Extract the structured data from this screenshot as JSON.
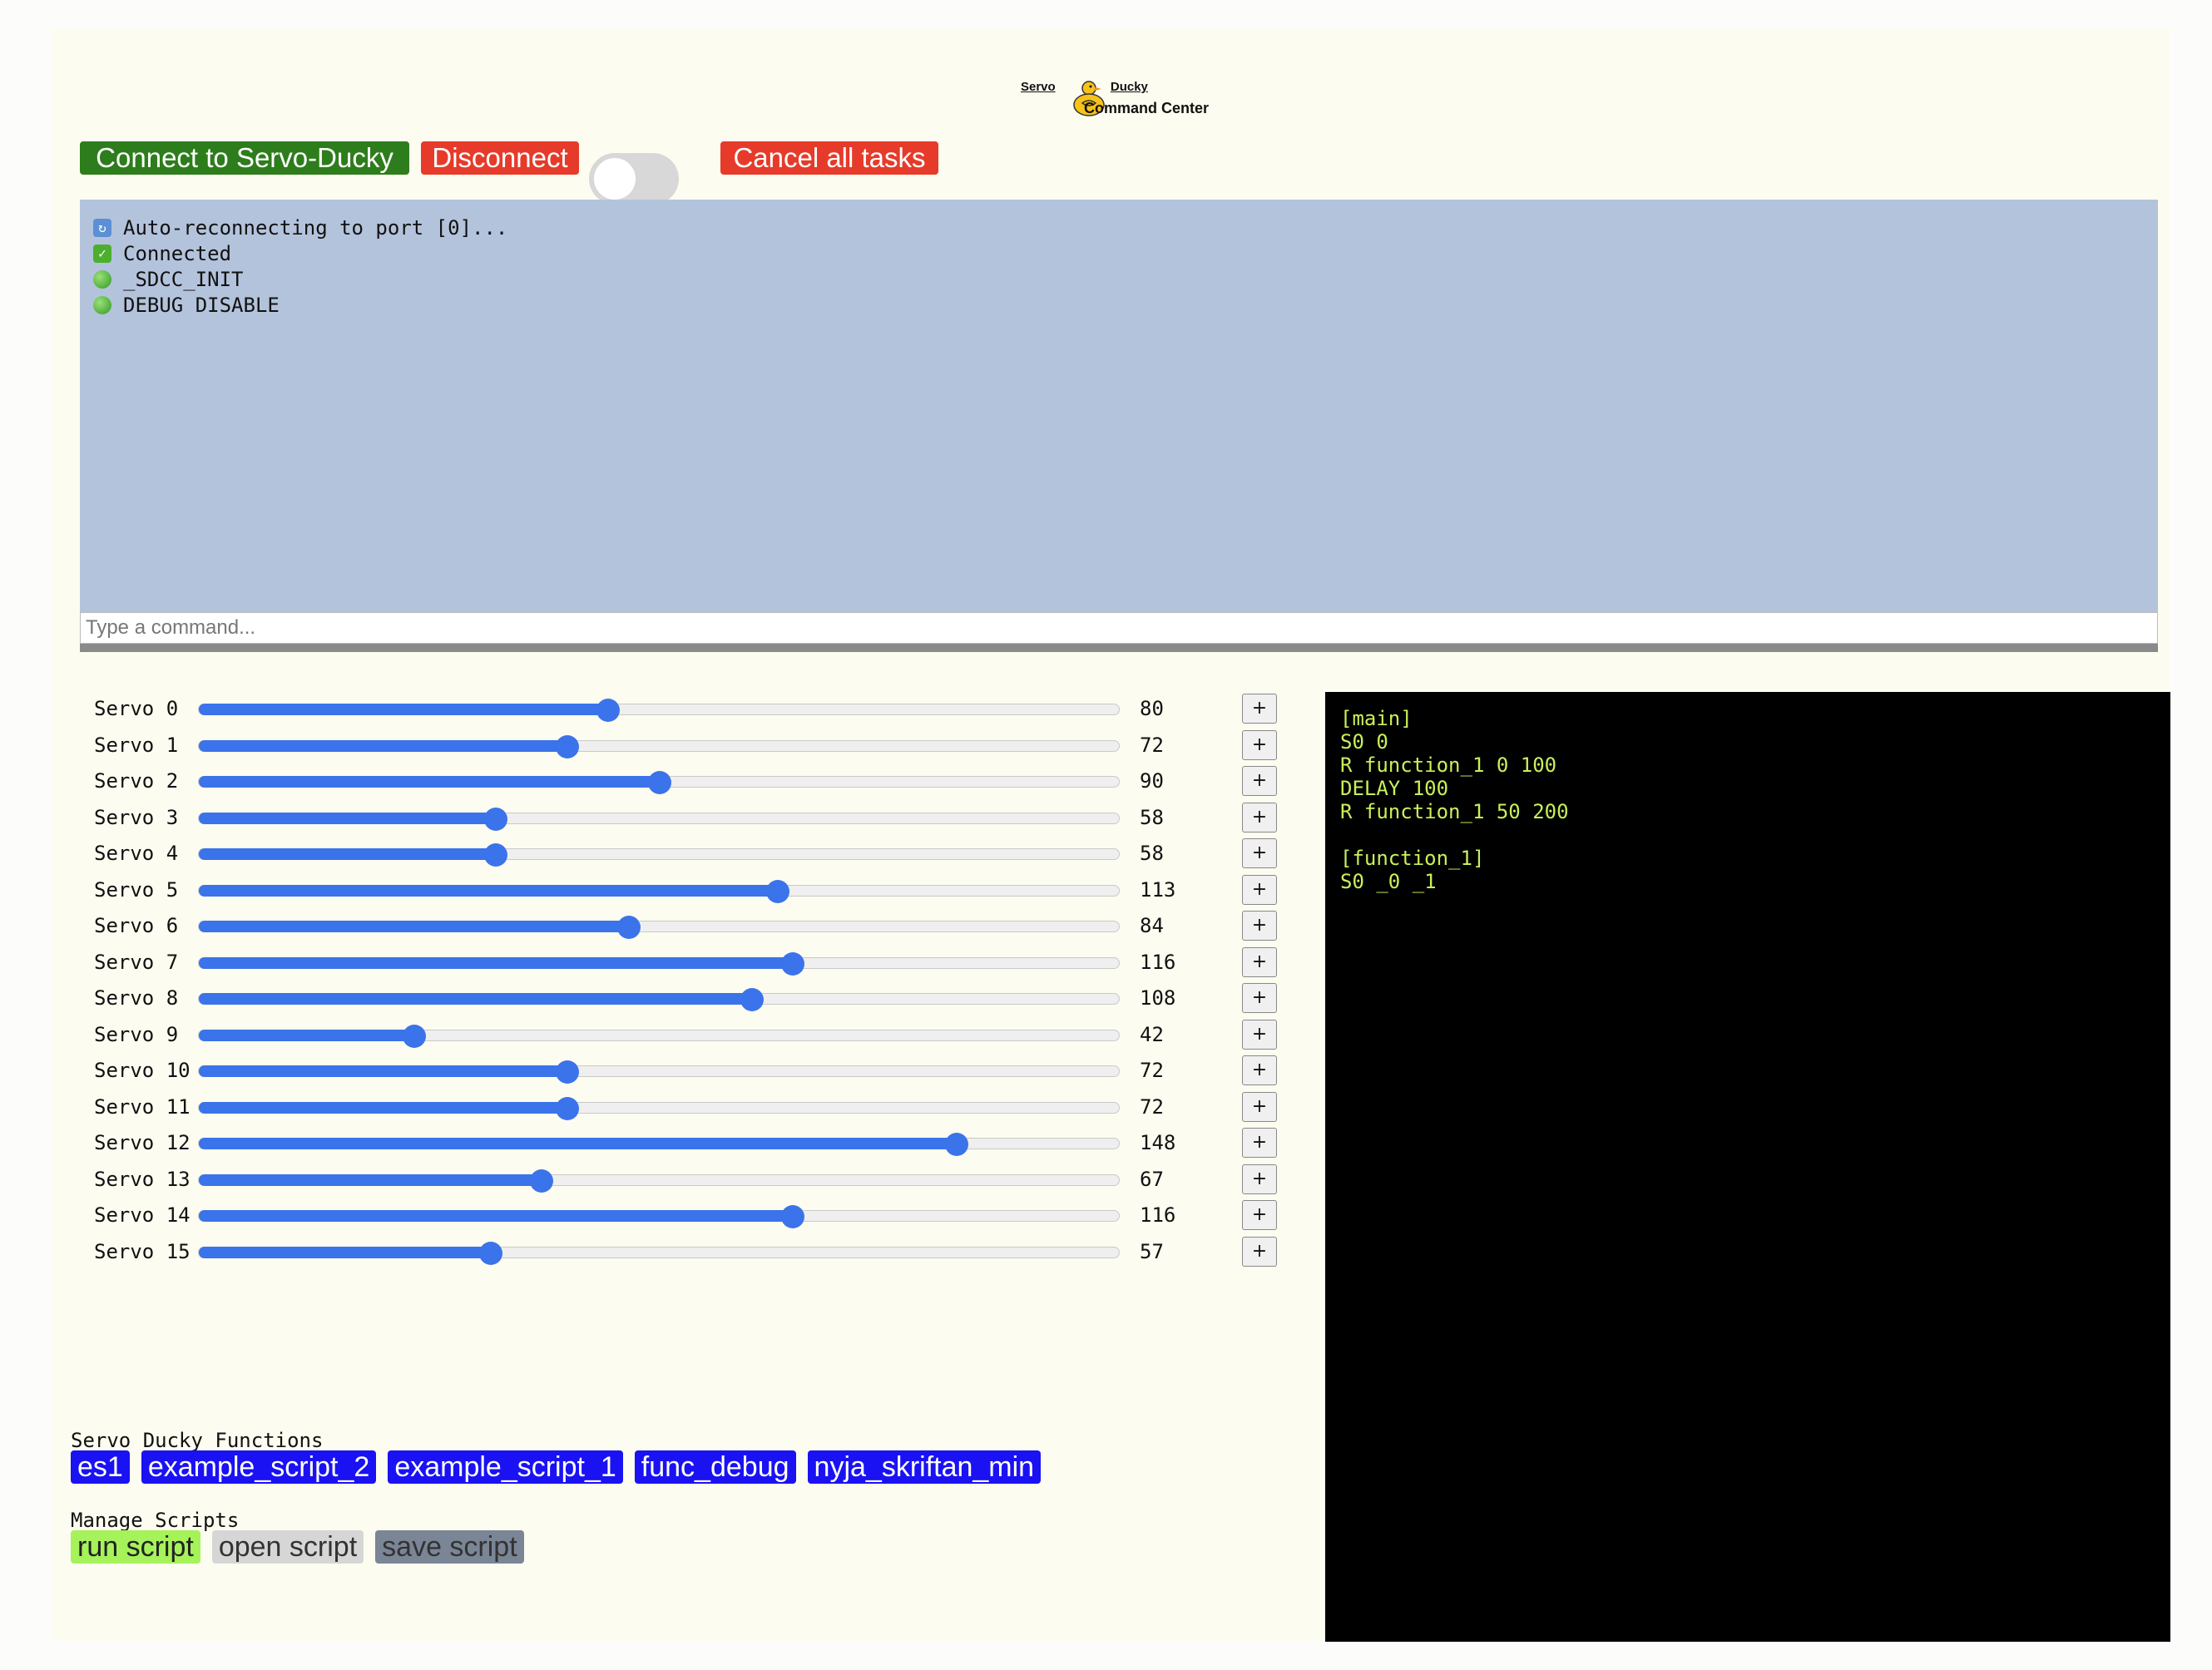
{
  "logo": {
    "top_left": "Servo",
    "top_right": "Ducky",
    "bottom": "Command Center"
  },
  "toolbar": {
    "connect_label": "Connect to Servo-Ducky",
    "disconnect_label": "Disconnect",
    "cancel_label": "Cancel all tasks",
    "toggle_on": false
  },
  "console": {
    "lines": [
      {
        "icon": "reconnect-icon",
        "text": "Auto-reconnecting to port [0]..."
      },
      {
        "icon": "checkmark-icon",
        "text": "Connected"
      },
      {
        "icon": "green-circle-icon",
        "text": "_SDCC_INIT"
      },
      {
        "icon": "green-circle-icon",
        "text": "DEBUG DISABLE"
      }
    ],
    "input_placeholder": "Type a command...",
    "input_value": ""
  },
  "servos": {
    "max": 180,
    "plus_label": "+",
    "items": [
      {
        "label": "Servo 0",
        "value": 80
      },
      {
        "label": "Servo 1",
        "value": 72
      },
      {
        "label": "Servo 2",
        "value": 90
      },
      {
        "label": "Servo 3",
        "value": 58
      },
      {
        "label": "Servo 4",
        "value": 58
      },
      {
        "label": "Servo 5",
        "value": 113
      },
      {
        "label": "Servo 6",
        "value": 84
      },
      {
        "label": "Servo 7",
        "value": 116
      },
      {
        "label": "Servo 8",
        "value": 108
      },
      {
        "label": "Servo 9",
        "value": 42
      },
      {
        "label": "Servo 10",
        "value": 72
      },
      {
        "label": "Servo 11",
        "value": 72
      },
      {
        "label": "Servo 12",
        "value": 148
      },
      {
        "label": "Servo 13",
        "value": 67
      },
      {
        "label": "Servo 14",
        "value": 116
      },
      {
        "label": "Servo 15",
        "value": 57
      }
    ]
  },
  "functions": {
    "title": "Servo Ducky Functions",
    "items": [
      "es1",
      "example_script_2",
      "example_script_1",
      "func_debug",
      "nyja_skriftan_min"
    ]
  },
  "manage": {
    "title": "Manage Scripts",
    "run_label": "run script",
    "open_label": "open script",
    "save_label": "save script"
  },
  "editor": {
    "lines": [
      "[main]",
      "S0 0",
      "R function_1 0 100",
      "DELAY 100",
      "R function_1 50 200",
      "",
      "[function_1]",
      "S0 _0 _1"
    ]
  },
  "colors": {
    "connect": "#2e7d1c",
    "danger": "#e63b2a",
    "console_bg": "#b4c3dc",
    "slider": "#3b73ea",
    "function_button": "#1a12f2",
    "run_button": "#a6f25a",
    "editor_text": "#c8f05a"
  }
}
